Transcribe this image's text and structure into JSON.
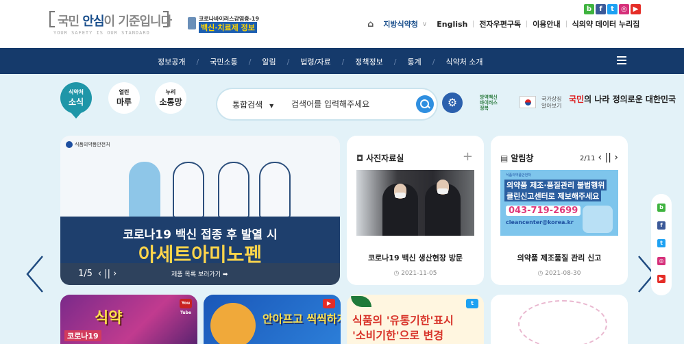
{
  "header": {
    "logo": {
      "main_a": "국민 ",
      "main_b": "안심",
      "main_c": "이 기준입니다",
      "sub": "YOUR SAFETY IS OUR STANDARD"
    },
    "covid_banner": {
      "line1": "코로나바이러스감염증-19",
      "line2": "백신·치료제 정보"
    },
    "sns_top": [
      {
        "name": "blog",
        "glyph": "b",
        "color": "#3fb33f"
      },
      {
        "name": "facebook",
        "glyph": "f",
        "color": "#3b5998"
      },
      {
        "name": "twitter",
        "glyph": "t",
        "color": "#1da1f2"
      },
      {
        "name": "instagram",
        "glyph": "◎",
        "color": "#d6307a"
      },
      {
        "name": "youtube",
        "glyph": "▶",
        "color": "#e52d27"
      }
    ],
    "topnav": {
      "home_icon": "home-icon",
      "region": "지방식약청",
      "english": "English",
      "subscribe": "전자우편구독",
      "guide": "이용안내",
      "data_portal": "식의약 데이터 누리집"
    }
  },
  "gnb": {
    "items": [
      "정보공개",
      "국민소통",
      "알림",
      "법령/자료",
      "정책정보",
      "통계",
      "식약처 소개"
    ]
  },
  "categories": [
    {
      "a": "식약처",
      "b": "소식",
      "active": true
    },
    {
      "a": "열린",
      "b": "마루",
      "active": false
    },
    {
      "a": "누리",
      "b": "소통망",
      "active": false
    }
  ],
  "search": {
    "scope": "통합검색",
    "placeholder": "검색어를 입력해주세요"
  },
  "banner_right": {
    "left_text": "방역백신 바이러스 정복",
    "national_symbol": "국가상징\n알아보기",
    "slogan_a": "국민",
    "slogan_b": "의 나라 정의로운 대한민국"
  },
  "main_slider": {
    "org": "식품의약품안전처",
    "line1": "코로나19 백신 접종 후 발열 시",
    "line2": "아세트아미노펜",
    "page": "1/5",
    "controls": "‹ || ›",
    "more": "제품 목록 보러가기 ➡"
  },
  "photo_card": {
    "title": "사진자료실",
    "plus": "+",
    "caption": "코로나19 백신 생산현장 방문",
    "date": "◷ 2021-11-05"
  },
  "notice_card": {
    "title": "알림창",
    "page": "2/11",
    "controls": "‹ || ›",
    "img_org": "식품의약품안전처",
    "img_line1": "의약품 제조·품질관리 불법행위",
    "img_line2": "클린신고센터로 제보해주세요",
    "img_tel": "043-719-2699",
    "img_mail": "cleancenter@korea.kr",
    "caption": "의약품 제조품질 관리 신고",
    "date": "◷ 2021-08-30"
  },
  "side_sns": [
    {
      "name": "blog",
      "glyph": "b",
      "color": "#3fb33f"
    },
    {
      "name": "facebook",
      "glyph": "f",
      "color": "#3b5998"
    },
    {
      "name": "twitter",
      "glyph": "t",
      "color": "#1da1f2"
    },
    {
      "name": "instagram",
      "glyph": "◎",
      "color": "#d6307a"
    },
    {
      "name": "youtube",
      "glyph": "▶",
      "color": "#e52d27"
    }
  ],
  "bottom_cards": {
    "c1": {
      "badge": "You Tube",
      "title": "식약",
      "subtitle": "코로나19"
    },
    "c2": {
      "badge": "▶",
      "title": "안아프고 씩씩하게"
    },
    "c3": {
      "badge": "t",
      "line1": "식품의 '유통기한'표시",
      "line2": "'소비기한'으로 변경"
    }
  },
  "colors": {
    "navy": "#153a6b",
    "teal": "#1f96a8",
    "sky_bg": "#e3f2f8"
  }
}
